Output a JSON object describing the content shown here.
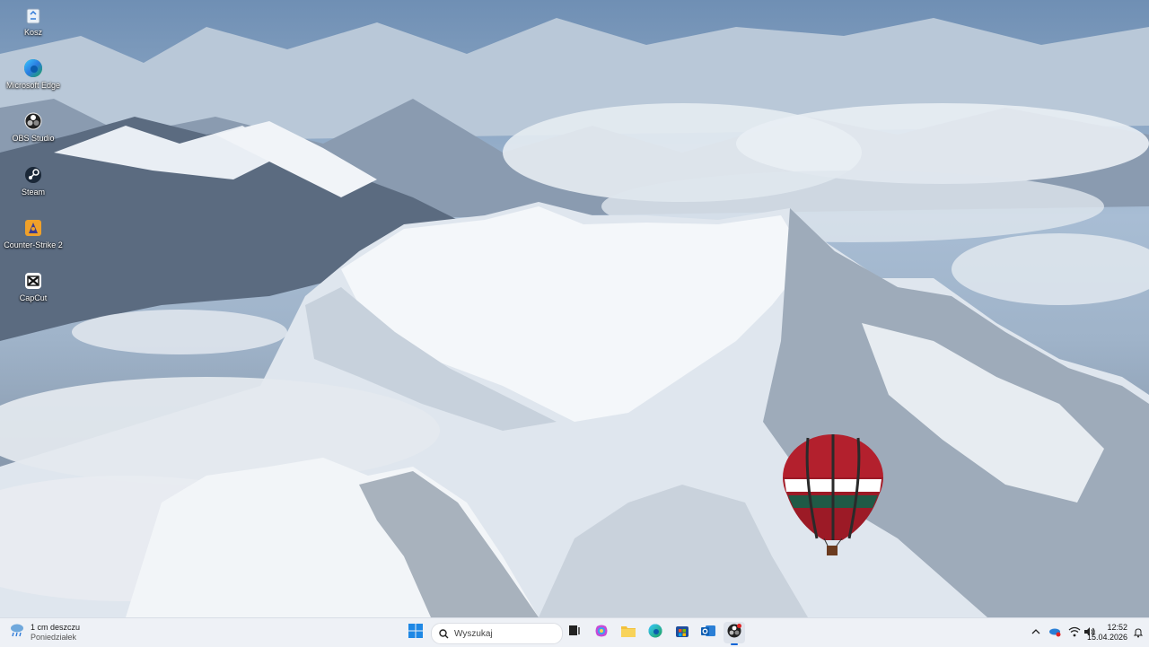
{
  "desktop": {
    "icons": [
      {
        "label": "Kosz"
      },
      {
        "label": "Microsoft Edge"
      },
      {
        "label": "OBS Studio"
      },
      {
        "label": "Steam"
      },
      {
        "label": "Counter-Strike 2"
      },
      {
        "label": "CapCut"
      }
    ]
  },
  "taskbar": {
    "weather": {
      "line1": "1 cm deszczu",
      "line2": "Poniedziałek"
    },
    "search": {
      "placeholder": "Wyszukaj"
    },
    "pinned": [
      "start-icon",
      "task-view-icon",
      "copilot-icon",
      "file-explorer-icon",
      "edge-icon",
      "store-icon",
      "outlook-icon",
      "obs-icon"
    ],
    "clock": {
      "time": "12:52",
      "date": "15.04.2026"
    }
  },
  "colors": {
    "taskbar_bg": "#eef1f6",
    "accent": "#0a64d6"
  }
}
